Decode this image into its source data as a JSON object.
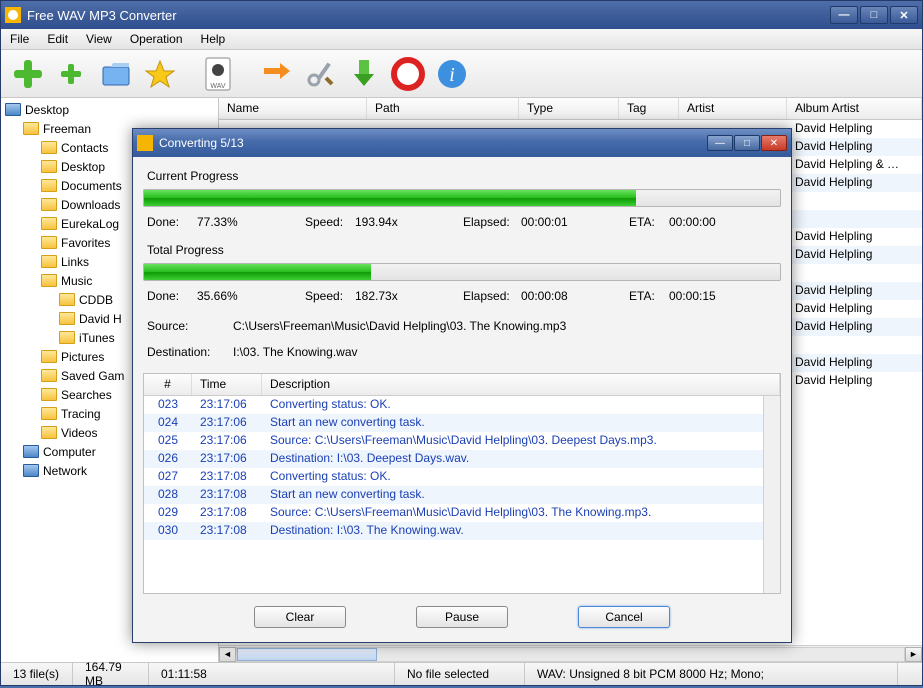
{
  "app": {
    "title": "Free WAV MP3 Converter",
    "menus": [
      "File",
      "Edit",
      "View",
      "Operation",
      "Help"
    ]
  },
  "tree": {
    "root": "Desktop",
    "user": "Freeman",
    "items": [
      "Contacts",
      "Desktop",
      "Documents",
      "Downloads",
      "EurekaLog",
      "Favorites",
      "Links",
      "Music"
    ],
    "music_children": [
      "CDDB",
      "David H",
      "iTunes"
    ],
    "after_music": [
      "Pictures",
      "Saved Gam",
      "Searches",
      "Tracing",
      "Videos"
    ],
    "computer": "Computer",
    "network": "Network"
  },
  "columns": [
    "Name",
    "Path",
    "Type",
    "Tag",
    "Artist",
    "Album Artist"
  ],
  "artists": [
    "David Helpling",
    "David Helpling",
    "David Helpling & …",
    "David Helpling",
    "",
    "",
    "David Helpling",
    "David Helpling",
    "",
    "David Helpling",
    "David Helpling",
    "David Helpling",
    "",
    "David Helpling",
    "David Helpling"
  ],
  "status": {
    "files": "13 file(s)",
    "size": "164.79 MB",
    "duration": "01:11:58",
    "selection": "No file selected",
    "format": "WAV:   Unsigned 8 bit PCM  8000 Hz;  Mono;"
  },
  "dialog": {
    "title": "Converting 5/13",
    "current": {
      "label": "Current Progress",
      "done_lbl": "Done:",
      "done": "77.33%",
      "speed_lbl": "Speed:",
      "speed": "193.94x",
      "elapsed_lbl": "Elapsed:",
      "elapsed": "00:00:01",
      "eta_lbl": "ETA:",
      "eta": "00:00:00",
      "pct": 77.33
    },
    "total": {
      "label": "Total Progress",
      "done_lbl": "Done:",
      "done": "35.66%",
      "speed_lbl": "Speed:",
      "speed": "182.73x",
      "elapsed_lbl": "Elapsed:",
      "elapsed": "00:00:08",
      "eta_lbl": "ETA:",
      "eta": "00:00:15",
      "pct": 35.66
    },
    "source_lbl": "Source:",
    "source": "C:\\Users\\Freeman\\Music\\David Helpling\\03. The Knowing.mp3",
    "dest_lbl": "Destination:",
    "dest": "I:\\03. The Knowing.wav",
    "log_cols": [
      "#",
      "Time",
      "Description"
    ],
    "logs": [
      {
        "n": "023",
        "t": "23:17:06",
        "d": "Converting status: OK."
      },
      {
        "n": "024",
        "t": "23:17:06",
        "d": "Start an new converting task."
      },
      {
        "n": "025",
        "t": "23:17:06",
        "d": "Source:  C:\\Users\\Freeman\\Music\\David Helpling\\03. Deepest Days.mp3."
      },
      {
        "n": "026",
        "t": "23:17:06",
        "d": "Destination: I:\\03. Deepest Days.wav."
      },
      {
        "n": "027",
        "t": "23:17:08",
        "d": "Converting status: OK."
      },
      {
        "n": "028",
        "t": "23:17:08",
        "d": "Start an new converting task."
      },
      {
        "n": "029",
        "t": "23:17:08",
        "d": "Source:  C:\\Users\\Freeman\\Music\\David Helpling\\03. The Knowing.mp3."
      },
      {
        "n": "030",
        "t": "23:17:08",
        "d": "Destination: I:\\03. The Knowing.wav."
      }
    ],
    "buttons": {
      "clear": "Clear",
      "pause": "Pause",
      "cancel": "Cancel"
    }
  }
}
